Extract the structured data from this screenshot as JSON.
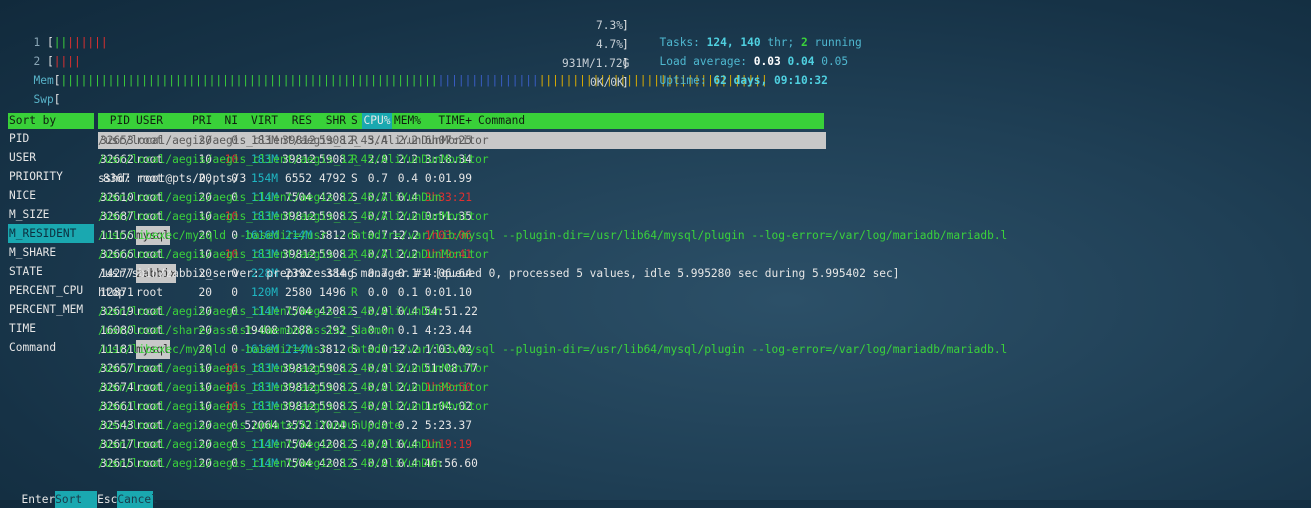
{
  "meters": {
    "cpu1": {
      "label": "1",
      "bar_red_count": 6,
      "bar_green_count": 2,
      "value": "7.3%"
    },
    "cpu2": {
      "label": "2",
      "bar_red_count": 4,
      "bar_green_count": 0,
      "value": "4.7%"
    },
    "mem": {
      "label": "Mem",
      "value": "931M/1.72G"
    },
    "swp": {
      "label": "Swp",
      "value": "0K/0K"
    }
  },
  "info": {
    "tasks_label": "Tasks:",
    "tasks_value": "124,",
    "thr_value": "140",
    "thr_label": "thr;",
    "running_value": "2",
    "running_label": "running",
    "load_label": "Load average:",
    "load1": "0.03",
    "load5": "0.04",
    "load15": "0.05",
    "uptime_label": "Uptime:",
    "uptime_value": "62 days, 09:10:32"
  },
  "sort_panel": {
    "title": "Sort by",
    "items": [
      "PID",
      "USER",
      "PRIORITY",
      "NICE",
      "M_SIZE",
      "M_RESIDENT",
      "M_SHARE",
      "STATE",
      "PERCENT_CPU",
      "PERCENT_MEM",
      "TIME",
      "Command"
    ],
    "selected": "M_RESIDENT"
  },
  "columns": {
    "pid": "PID",
    "user": "USER",
    "pri": "PRI",
    "ni": "NI",
    "virt": "VIRT",
    "res": "RES",
    "shr": "SHR",
    "s": "S",
    "cpu": "CPU%",
    "mem": "MEM%",
    "time": "TIME+",
    "command": "Command"
  },
  "processes": [
    {
      "pid": "32653",
      "user": "root",
      "pri": "20",
      "ni": "0",
      "virt": "183M",
      "res": "39812",
      "shr": "5908",
      "s": "R",
      "cpu": "3.4",
      "mem": "2.2",
      "time": "6h07:25",
      "command": "/usr/local/aegis/aegis_client/aegis_12_45/AliYunDunMonitor"
    },
    {
      "pid": "32662",
      "user": "root",
      "pri": "10",
      "ni": "-10",
      "virt": "183M",
      "res": "39812",
      "shr": "5908",
      "s": "R",
      "cpu": "2.0",
      "mem": "2.2",
      "time": "3:18.34",
      "command": "/usr/local/aegis/aegis_client/aegis_12_45/AliYunDunMonitor"
    },
    {
      "pid": "8367",
      "user": "root",
      "pri": "20",
      "ni": "0",
      "virt": "154M",
      "res": "6552",
      "shr": "4792",
      "s": "S",
      "cpu": "0.7",
      "mem": "0.4",
      "time": "0:01.99",
      "command": "sshd: root@pts/0,pts/3"
    },
    {
      "pid": "32610",
      "user": "root",
      "pri": "20",
      "ni": "0",
      "virt": "114M",
      "res": "7504",
      "shr": "4208",
      "s": "S",
      "cpu": "0.7",
      "mem": "0.4",
      "time": "3h33:21",
      "command": "/usr/local/aegis/aegis_client/aegis_12_45/AliYunDun"
    },
    {
      "pid": "32687",
      "user": "root",
      "pri": "10",
      "ni": "-10",
      "virt": "183M",
      "res": "39812",
      "shr": "5908",
      "s": "S",
      "cpu": "0.7",
      "mem": "2.2",
      "time": "0:51.35",
      "command": "/usr/local/aegis/aegis_client/aegis_12_45/AliYunDunMonitor"
    },
    {
      "pid": "11156",
      "user": "mysql",
      "pri": "20",
      "ni": "0",
      "virt": "1616M",
      "res": "214M",
      "shr": "3812",
      "s": "S",
      "cpu": "0.7",
      "mem": "12.2",
      "time": "1h03:06",
      "command": "/usr/libexec/mysqld --basedir=/usr --datadir=/var/lib/mysql --plugin-dir=/usr/lib64/mysql/plugin --log-error=/var/log/mariadb/mariadb.l"
    },
    {
      "pid": "32666",
      "user": "root",
      "pri": "10",
      "ni": "-10",
      "virt": "183M",
      "res": "39812",
      "shr": "5908",
      "s": "R",
      "cpu": "0.7",
      "mem": "2.2",
      "time": "1h19:41",
      "command": "/usr/local/aegis/aegis_client/aegis_12_45/AliYunDunMonitor"
    },
    {
      "pid": "14277",
      "user": "zabbix",
      "pri": "20",
      "ni": "0",
      "virt": "228M",
      "res": "2392",
      "shr": "384",
      "s": "S",
      "cpu": "0.7",
      "mem": "0.1",
      "time": "4:06.64",
      "command": "/usr/sbin/zabbix_server: preprocessing manager #1 [queued 0, processed 5 values, idle 5.995280 sec during 5.995402 sec]"
    },
    {
      "pid": "12871",
      "user": "root",
      "pri": "20",
      "ni": "0",
      "virt": "120M",
      "res": "2580",
      "shr": "1496",
      "s": "R",
      "cpu": "0.0",
      "mem": "0.1",
      "time": "0:01.10",
      "command": "htop"
    },
    {
      "pid": "32619",
      "user": "root",
      "pri": "20",
      "ni": "0",
      "virt": "114M",
      "res": "7504",
      "shr": "4208",
      "s": "S",
      "cpu": "0.0",
      "mem": "0.4",
      "time": "54:51.22",
      "command": "/usr/local/aegis/aegis_client/aegis_12_45/AliYunDun"
    },
    {
      "pid": "16080",
      "user": "root",
      "pri": "20",
      "ni": "0",
      "virt": "19408",
      "res": "1288",
      "shr": "292",
      "s": "S",
      "cpu": "0.0",
      "mem": "0.1",
      "time": "4:23.44",
      "command": "/usr/local/share/assist-daemon/assist_daemon"
    },
    {
      "pid": "11181",
      "user": "mysql",
      "pri": "20",
      "ni": "0",
      "virt": "1616M",
      "res": "214M",
      "shr": "3812",
      "s": "S",
      "cpu": "0.0",
      "mem": "12.2",
      "time": "1:03.02",
      "command": "/usr/libexec/mysqld --basedir=/usr --datadir=/var/lib/mysql --plugin-dir=/usr/lib64/mysql/plugin --log-error=/var/log/mariadb/mariadb.l"
    },
    {
      "pid": "32657",
      "user": "root",
      "pri": "10",
      "ni": "-10",
      "virt": "183M",
      "res": "39812",
      "shr": "5908",
      "s": "S",
      "cpu": "0.0",
      "mem": "2.2",
      "time": "51:08.77",
      "command": "/usr/local/aegis/aegis_client/aegis_12_45/AliYunDunMonitor"
    },
    {
      "pid": "32674",
      "user": "root",
      "pri": "10",
      "ni": "-10",
      "virt": "183M",
      "res": "39812",
      "shr": "5908",
      "s": "S",
      "cpu": "0.0",
      "mem": "2.2",
      "time": "1h39:50",
      "command": "/usr/local/aegis/aegis_client/aegis_12_45/AliYunDunMonitor"
    },
    {
      "pid": "32661",
      "user": "root",
      "pri": "10",
      "ni": "-10",
      "virt": "183M",
      "res": "39812",
      "shr": "5908",
      "s": "S",
      "cpu": "0.0",
      "mem": "2.2",
      "time": "1:04.02",
      "command": "/usr/local/aegis/aegis_client/aegis_12_45/AliYunDunMonitor"
    },
    {
      "pid": "32543",
      "user": "root",
      "pri": "20",
      "ni": "0",
      "virt": "52064",
      "res": "3552",
      "shr": "2024",
      "s": "S",
      "cpu": "0.0",
      "mem": "0.2",
      "time": "5:23.37",
      "command": "/usr/local/aegis/aegis_update/AliYunDunUpdate"
    },
    {
      "pid": "32617",
      "user": "root",
      "pri": "20",
      "ni": "0",
      "virt": "114M",
      "res": "7504",
      "shr": "4208",
      "s": "S",
      "cpu": "0.0",
      "mem": "0.4",
      "time": "1h19:19",
      "command": "/usr/local/aegis/aegis_client/aegis_12_45/AliYunDun"
    },
    {
      "pid": "32615",
      "user": "root",
      "pri": "20",
      "ni": "0",
      "virt": "114M",
      "res": "7504",
      "shr": "4208",
      "s": "S",
      "cpu": "0.0",
      "mem": "0.4",
      "time": "46:56.60",
      "command": "/usr/local/aegis/aegis_client/aegis_12_45/AliYunDun"
    }
  ],
  "footer": {
    "enter_key": "Enter",
    "enter_action": "Sort",
    "esc_key": "Esc",
    "esc_action": "Cancel"
  },
  "colors": {
    "accent_green": "#39d139",
    "accent_cyan": "#1aa8b0",
    "negative_red": "#e03030",
    "background": "#1f3f55"
  }
}
